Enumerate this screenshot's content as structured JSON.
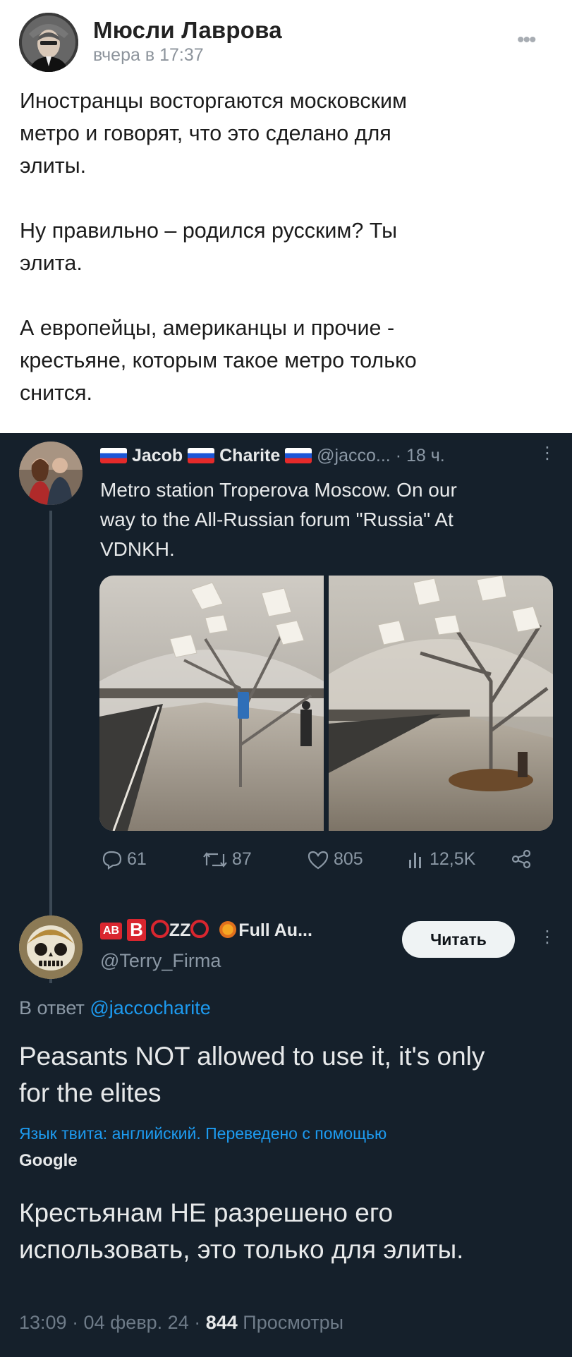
{
  "vk_post": {
    "author": "Мюсли Лаврова",
    "time": "вчера в 17:37",
    "more_icon": "ellipsis-icon",
    "paragraphs": [
      [
        "Иностранцы восторгаются московским",
        "метро и говорят, что это сделано для",
        "элиты."
      ],
      [
        "Ну правильно – родился русским? Ты",
        "элита."
      ],
      [
        "А европейцы, американцы и прочие -",
        "крестьяне, которым такое метро только",
        "снится."
      ]
    ]
  },
  "tweet": {
    "author_name": "Jacob",
    "author_name2": "Charite",
    "handle": "@jacco...",
    "time": "· 18 ч.",
    "text_lines": [
      "Metro station Troperova Moscow. On our",
      "way to the All-Russian forum \"Russia\" At",
      "VDNKH."
    ],
    "actions": {
      "replies": "61",
      "retweets": "87",
      "likes": "805",
      "views": "12,5K"
    }
  },
  "reply": {
    "name_suffix": "Full Au...",
    "badge_ab": "AB",
    "badge_b": "B",
    "letters_zz": "ZZ",
    "handle": "@Terry_Firma",
    "follow_label": "Читать",
    "reply_prefix": "В ответ",
    "reply_handle": "@jaccocharite",
    "text_lines": [
      "Peasants NOT allowed to use it, it's only",
      "for the elites"
    ],
    "translate_note": "Язык твита: английский. Переведено с помощью",
    "translate_by": "Google",
    "translated_lines": [
      "Крестьянам НЕ разрешено его",
      "использовать, это только для элиты."
    ],
    "meta_time": "13:09 · 04 февр. 24 · ",
    "meta_views": "844",
    "meta_views_label": " Просмотры"
  },
  "colors": {
    "twitter_bg": "#15202b",
    "link_blue": "#1d9bf0",
    "badge_red": "#d9262f"
  }
}
